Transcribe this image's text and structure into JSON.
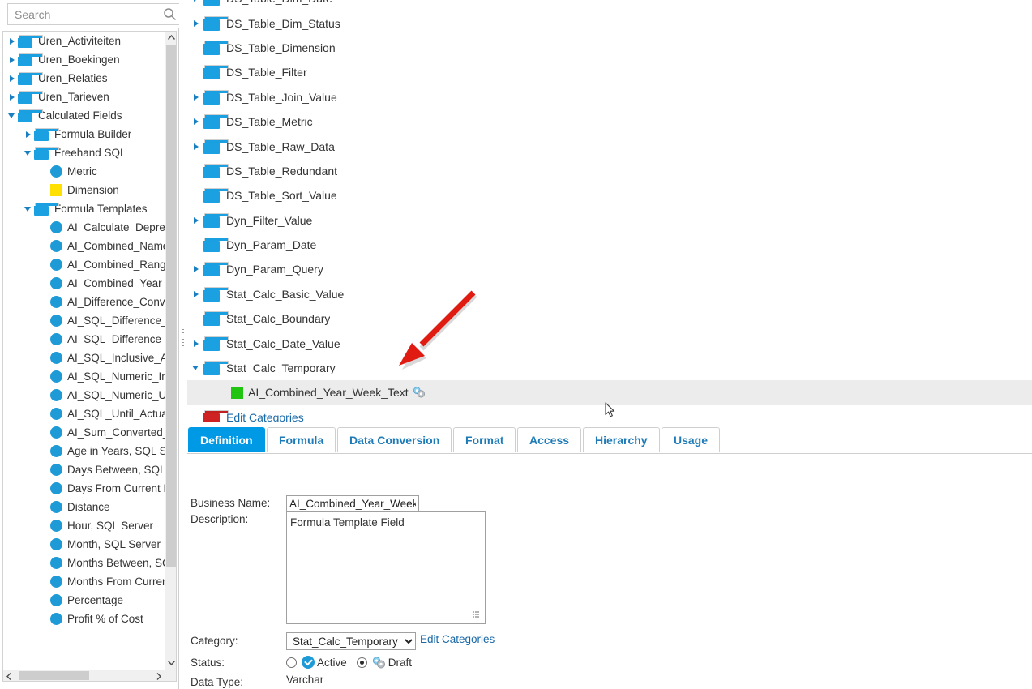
{
  "search": {
    "placeholder": "Search",
    "value": "",
    "icon": "search-icon",
    "expand_all_icon": "expand-all-icon",
    "collapse_all_icon": "collapse-all-icon"
  },
  "sidebar": {
    "items": [
      {
        "label": "Uren_Activiteiten",
        "kind": "folder",
        "twisty": "right",
        "indent": 0
      },
      {
        "label": "Uren_Boekingen",
        "kind": "folder",
        "twisty": "right",
        "indent": 0
      },
      {
        "label": "Uren_Relaties",
        "kind": "folder",
        "twisty": "right",
        "indent": 0
      },
      {
        "label": "Uren_Tarieven",
        "kind": "folder",
        "twisty": "right",
        "indent": 0
      },
      {
        "label": "Calculated Fields",
        "kind": "folder",
        "twisty": "down",
        "indent": 0
      },
      {
        "label": "Formula Builder",
        "kind": "folder",
        "twisty": "right",
        "indent": 1
      },
      {
        "label": "Freehand SQL",
        "kind": "folder",
        "twisty": "down",
        "indent": 1
      },
      {
        "label": "Metric",
        "kind": "metric",
        "twisty": "none",
        "indent": 2
      },
      {
        "label": "Dimension",
        "kind": "dimension",
        "twisty": "none",
        "indent": 2
      },
      {
        "label": "Formula Templates",
        "kind": "folder",
        "twisty": "down",
        "indent": 1
      },
      {
        "label": "AI_Calculate_Deprec",
        "kind": "metric",
        "twisty": "none",
        "indent": 2
      },
      {
        "label": "AI_Combined_Name",
        "kind": "metric",
        "twisty": "none",
        "indent": 2
      },
      {
        "label": "AI_Combined_Range",
        "kind": "metric",
        "twisty": "none",
        "indent": 2
      },
      {
        "label": "AI_Combined_Year_",
        "kind": "metric",
        "twisty": "none",
        "indent": 2
      },
      {
        "label": "AI_Difference_Conve",
        "kind": "metric",
        "twisty": "none",
        "indent": 2
      },
      {
        "label": "AI_SQL_Difference_I",
        "kind": "metric",
        "twisty": "none",
        "indent": 2
      },
      {
        "label": "AI_SQL_Difference_U",
        "kind": "metric",
        "twisty": "none",
        "indent": 2
      },
      {
        "label": "AI_SQL_Inclusive_Ac",
        "kind": "metric",
        "twisty": "none",
        "indent": 2
      },
      {
        "label": "AI_SQL_Numeric_In",
        "kind": "metric",
        "twisty": "none",
        "indent": 2
      },
      {
        "label": "AI_SQL_Numeric_Un",
        "kind": "metric",
        "twisty": "none",
        "indent": 2
      },
      {
        "label": "AI_SQL_Until_Actua",
        "kind": "metric",
        "twisty": "none",
        "indent": 2
      },
      {
        "label": "AI_Sum_Converted_",
        "kind": "metric",
        "twisty": "none",
        "indent": 2
      },
      {
        "label": "Age in Years, SQL Ser",
        "kind": "metric",
        "twisty": "none",
        "indent": 2
      },
      {
        "label": "Days Between, SQL S",
        "kind": "metric",
        "twisty": "none",
        "indent": 2
      },
      {
        "label": "Days From Current D",
        "kind": "metric",
        "twisty": "none",
        "indent": 2
      },
      {
        "label": "Distance",
        "kind": "metric",
        "twisty": "none",
        "indent": 2
      },
      {
        "label": "Hour, SQL Server",
        "kind": "metric",
        "twisty": "none",
        "indent": 2
      },
      {
        "label": "Month, SQL Server",
        "kind": "metric",
        "twisty": "none",
        "indent": 2
      },
      {
        "label": "Months Between, SQ",
        "kind": "metric",
        "twisty": "none",
        "indent": 2
      },
      {
        "label": "Months From Curren",
        "kind": "metric",
        "twisty": "none",
        "indent": 2
      },
      {
        "label": "Percentage",
        "kind": "metric",
        "twisty": "none",
        "indent": 2
      },
      {
        "label": "Profit % of Cost",
        "kind": "metric",
        "twisty": "none",
        "indent": 2
      }
    ]
  },
  "main_tree": {
    "items": [
      {
        "label": "DS_Table_Dim_Date",
        "kind": "folder",
        "twisty": "right",
        "indent": 1,
        "clipped": true
      },
      {
        "label": "DS_Table_Dim_Status",
        "kind": "folder",
        "twisty": "right",
        "indent": 1
      },
      {
        "label": "DS_Table_Dimension",
        "kind": "folder",
        "twisty": "none",
        "indent": 1
      },
      {
        "label": "DS_Table_Filter",
        "kind": "folder",
        "twisty": "none",
        "indent": 1
      },
      {
        "label": "DS_Table_Join_Value",
        "kind": "folder",
        "twisty": "right",
        "indent": 1
      },
      {
        "label": "DS_Table_Metric",
        "kind": "folder",
        "twisty": "right",
        "indent": 1
      },
      {
        "label": "DS_Table_Raw_Data",
        "kind": "folder",
        "twisty": "right",
        "indent": 1
      },
      {
        "label": "DS_Table_Redundant",
        "kind": "folder",
        "twisty": "none",
        "indent": 1
      },
      {
        "label": "DS_Table_Sort_Value",
        "kind": "folder",
        "twisty": "none",
        "indent": 1
      },
      {
        "label": "Dyn_Filter_Value",
        "kind": "folder",
        "twisty": "right",
        "indent": 1
      },
      {
        "label": "Dyn_Param_Date",
        "kind": "folder",
        "twisty": "none",
        "indent": 1
      },
      {
        "label": "Dyn_Param_Query",
        "kind": "folder",
        "twisty": "right",
        "indent": 1
      },
      {
        "label": "Stat_Calc_Basic_Value",
        "kind": "folder",
        "twisty": "right",
        "indent": 1
      },
      {
        "label": "Stat_Calc_Boundary",
        "kind": "folder",
        "twisty": "none",
        "indent": 1
      },
      {
        "label": "Stat_Calc_Date_Value",
        "kind": "folder",
        "twisty": "right",
        "indent": 1
      },
      {
        "label": "Stat_Calc_Temporary",
        "kind": "folder",
        "twisty": "down",
        "indent": 1
      },
      {
        "label": "AI_Combined_Year_Week_Text",
        "kind": "field-draft",
        "twisty": "none",
        "indent": 2,
        "selected": true
      },
      {
        "label": "Edit Categories",
        "kind": "edit-categories",
        "twisty": "none",
        "indent": 1
      }
    ]
  },
  "tabs": [
    {
      "label": "Definition",
      "active": true
    },
    {
      "label": "Formula",
      "active": false
    },
    {
      "label": "Data Conversion",
      "active": false
    },
    {
      "label": "Format",
      "active": false
    },
    {
      "label": "Access",
      "active": false
    },
    {
      "label": "Hierarchy",
      "active": false
    },
    {
      "label": "Usage",
      "active": false
    }
  ],
  "definition": {
    "business_name_label": "Business Name:",
    "business_name_value": "AI_Combined_Year_Week_T",
    "description_label": "Description:",
    "description_value": "Formula Template Field",
    "category_label": "Category:",
    "category_value": "Stat_Calc_Temporary",
    "category_options": [
      "Stat_Calc_Temporary"
    ],
    "edit_categories_link": "Edit Categories",
    "status_label": "Status:",
    "status_active_label": "Active",
    "status_draft_label": "Draft",
    "status_selected": "Draft",
    "data_type_label": "Data Type:",
    "data_type_value": "Varchar"
  },
  "annotation": {
    "arrow": "red-arrow-pointing-to-selected-field"
  },
  "colors": {
    "accent_blue": "#0099e5",
    "folder_blue": "#1ba1e2",
    "metric_blue": "#1e9ad6",
    "dimension_yellow": "#ffe000",
    "field_green": "#22c412",
    "link_blue": "#1868a8",
    "annotation_red": "#e01b11",
    "selected_row": "#ececec"
  }
}
